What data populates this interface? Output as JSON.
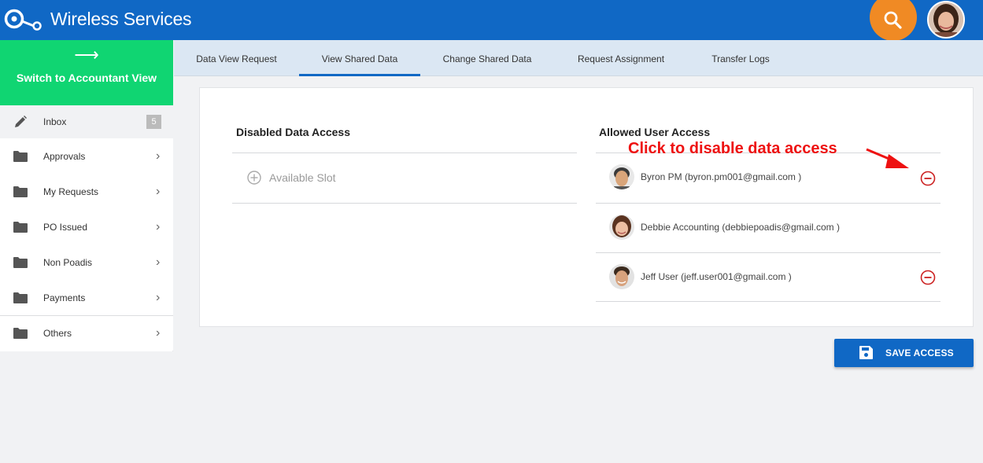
{
  "app": {
    "title": "Wireless Services"
  },
  "header": {
    "search_icon": "search-icon",
    "avatar": "user-avatar"
  },
  "sidebar": {
    "switch_view_label": "Switch to Accountant View",
    "switch_view_icon": "arrow-right-icon",
    "items": [
      {
        "label": "Inbox",
        "icon": "pencil-icon",
        "badge": "5"
      },
      {
        "label": "Approvals",
        "icon": "folder-icon"
      },
      {
        "label": "My Requests",
        "icon": "folder-icon"
      },
      {
        "label": "PO Issued",
        "icon": "folder-icon"
      },
      {
        "label": "Non Poadis",
        "icon": "folder-icon"
      },
      {
        "label": "Payments",
        "icon": "folder-icon"
      },
      {
        "label": "Others",
        "icon": "folder-icon"
      }
    ]
  },
  "tabs": [
    {
      "label": "Data View Request"
    },
    {
      "label": "View Shared Data",
      "active": true
    },
    {
      "label": "Change Shared Data"
    },
    {
      "label": "Request Assignment"
    },
    {
      "label": "Transfer Logs"
    }
  ],
  "main": {
    "disabled_title": "Disabled Data Access",
    "available_slot": "Available Slot",
    "allowed_title": "Allowed User Access",
    "annotation": "Click to disable data access",
    "users": [
      {
        "label": "Byron PM (byron.pm001@gmail.com )",
        "removable": true
      },
      {
        "label": "Debbie Accounting (debbiepoadis@gmail.com )",
        "removable": false
      },
      {
        "label": "Jeff User (jeff.user001@gmail.com )",
        "removable": true
      }
    ],
    "save_label": "SAVE ACCESS"
  },
  "colors": {
    "brand_blue": "#1068c5",
    "accent_green": "#10d572",
    "search_orange": "#f08a24",
    "danger_red": "#cc2222",
    "annotation_red": "#ee1111"
  }
}
